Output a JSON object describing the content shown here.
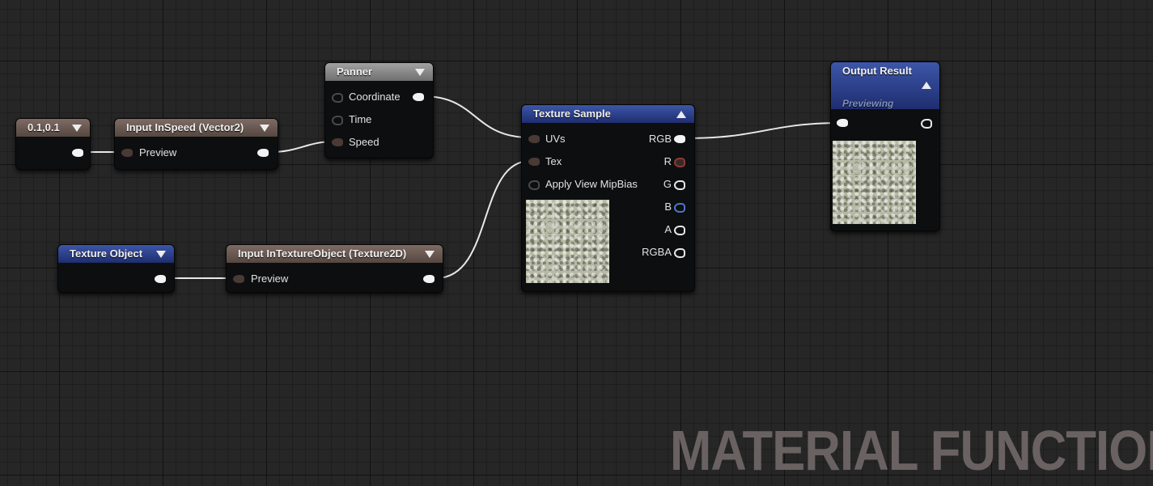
{
  "nodes": {
    "constant": {
      "title": "0.1,0.1"
    },
    "input_speed": {
      "title": "Input InSpeed (Vector2)",
      "preview_label": "Preview"
    },
    "panner": {
      "title": "Panner",
      "coordinate": "Coordinate",
      "time": "Time",
      "speed": "Speed"
    },
    "texture_object": {
      "title": "Texture Object"
    },
    "input_texture": {
      "title": "Input InTextureObject (Texture2D)",
      "preview_label": "Preview"
    },
    "texture_sample": {
      "title": "Texture Sample",
      "uvs": "UVs",
      "tex": "Tex",
      "mipbias": "Apply View MipBias",
      "rgb": "RGB",
      "r": "R",
      "g": "G",
      "b": "B",
      "a": "A",
      "rgba": "RGBA"
    },
    "output": {
      "title": "Output Result",
      "caption": "Previewing"
    }
  },
  "watermark": "MATERIAL FUNCTION",
  "colors": {
    "graph_bg": "#262626",
    "header_brown": "#6b5a52",
    "header_gray": "#8c8c8c",
    "header_blue": "#2d42a0",
    "wire": "#e8e8e8"
  }
}
